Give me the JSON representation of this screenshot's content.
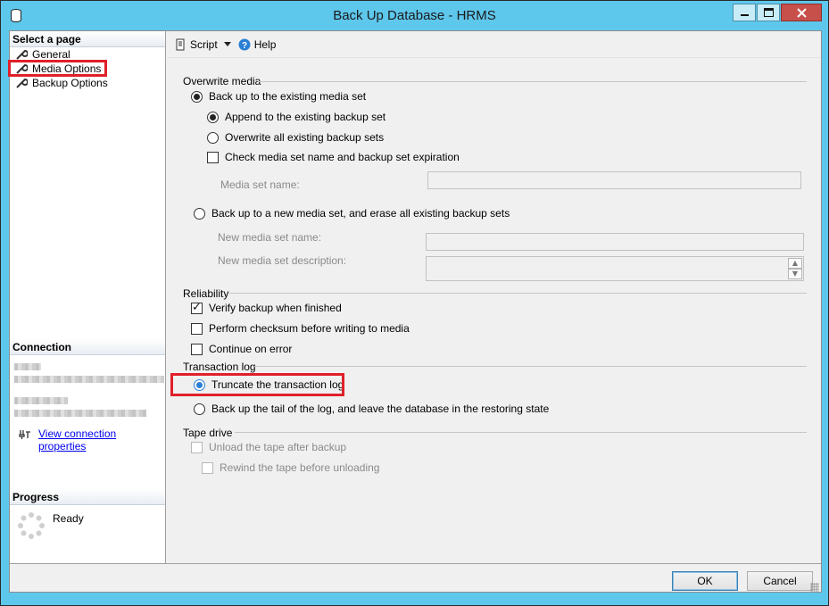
{
  "window": {
    "title": "Back Up Database - HRMS",
    "accent": "#5ec7ec",
    "close_color": "#c7504a"
  },
  "sidebar": {
    "select_page_header": "Select a page",
    "pages": [
      {
        "label": "General",
        "icon": "wrench-icon"
      },
      {
        "label": "Media Options",
        "icon": "wrench-icon",
        "highlighted": true
      },
      {
        "label": "Backup Options",
        "icon": "wrench-icon"
      }
    ],
    "connection_header": "Connection",
    "view_connection_link": "View connection properties",
    "progress_header": "Progress",
    "progress_status": "Ready"
  },
  "toolbar": {
    "script_label": "Script",
    "help_label": "Help"
  },
  "overwrite_media": {
    "label": "Overwrite media",
    "backup_existing": "Back up to the existing media set",
    "append": "Append to the existing backup set",
    "overwrite_all": "Overwrite all existing backup sets",
    "check_media": "Check media set name and backup set expiration",
    "media_set_name_label": "Media set name:",
    "backup_new": "Back up to a new media set, and erase all existing backup sets",
    "new_media_set_name_label": "New media set name:",
    "new_media_set_desc_label": "New media set description:"
  },
  "reliability": {
    "label": "Reliability",
    "verify": "Verify backup when finished",
    "checksum": "Perform checksum before writing to media",
    "continue_on_error": "Continue on error"
  },
  "transaction_log": {
    "label": "Transaction log",
    "truncate": "Truncate the transaction log",
    "tail": "Back up the tail of the log, and leave the database in the restoring state"
  },
  "tape_drive": {
    "label": "Tape drive",
    "unload": "Unload the tape after backup",
    "rewind": "Rewind the tape before unloading"
  },
  "buttons": {
    "ok": "OK",
    "cancel": "Cancel"
  },
  "highlight_color": "#e0202a"
}
